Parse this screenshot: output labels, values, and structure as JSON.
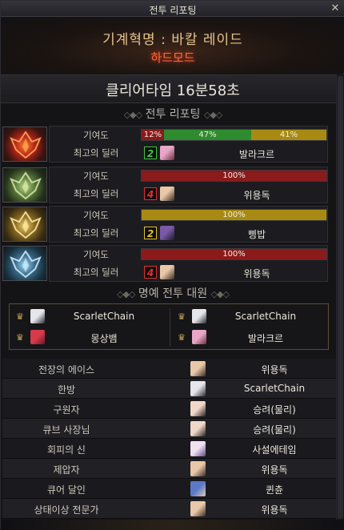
{
  "window": {
    "title": "전투 리포팅",
    "close_label": "✕"
  },
  "header": {
    "raid_title": "기계혁명 : 바칼 레이드",
    "difficulty": "하드모드"
  },
  "clear": {
    "time_text": "클리어타임  16분58초"
  },
  "sections": {
    "report": "전투 리포팅",
    "honor": "명예 전투 대원",
    "deco_left": "◇◆◇",
    "deco_right": "◇◆◇"
  },
  "labels": {
    "contribution": "기여도",
    "top_dealer": "최고의 딜러"
  },
  "bosses": [
    {
      "portrait": "boss-red-icon",
      "segments": [
        {
          "label": "12%",
          "value": 12,
          "color": "#8b1a1a"
        },
        {
          "label": "47%",
          "value": 47,
          "color": "#2e8b2e"
        },
        {
          "label": "41%",
          "value": 41,
          "color": "#a88a12"
        }
      ],
      "grade": "2",
      "grade_color": "#3fc43f",
      "dealer": "발라크르",
      "avatar_colors": [
        "#e8a6c8",
        "#6a2f3a"
      ]
    },
    {
      "portrait": "boss-green-icon",
      "segments": [
        {
          "label": "100%",
          "value": 100,
          "color": "#8b1a1a"
        }
      ],
      "grade": "4",
      "grade_color": "#e03030",
      "dealer": "위용독",
      "avatar_colors": [
        "#e9c7a8",
        "#3a2a22"
      ]
    },
    {
      "portrait": "boss-gold-icon",
      "segments": [
        {
          "label": "100%",
          "value": 100,
          "color": "#a88a12"
        }
      ],
      "grade": "2",
      "grade_color": "#e0c030",
      "dealer": "삥밥",
      "avatar_colors": [
        "#7a5aa8",
        "#1a1a2a"
      ]
    },
    {
      "portrait": "boss-blue-icon",
      "segments": [
        {
          "label": "100%",
          "value": 100,
          "color": "#8b1a1a"
        }
      ],
      "grade": "4",
      "grade_color": "#e03030",
      "dealer": "위용독",
      "avatar_colors": [
        "#e9c7a8",
        "#3a2a22"
      ]
    }
  ],
  "honor": [
    {
      "name": "ScarletChain",
      "avatar_colors": [
        "#e6e6ea",
        "#2a2a34"
      ]
    },
    {
      "name": "ScarletChain",
      "avatar_colors": [
        "#e6e6ea",
        "#2a2a34"
      ]
    },
    {
      "name": "몽상뱀",
      "avatar_colors": [
        "#d83a4a",
        "#6a1a2a"
      ]
    },
    {
      "name": "발라크르",
      "avatar_colors": [
        "#e8a6c8",
        "#6a2f3a"
      ]
    }
  ],
  "awards": [
    {
      "title": "전장의 에이스",
      "name": "위용독",
      "avatar_colors": [
        "#e9c7a8",
        "#3a2a22"
      ]
    },
    {
      "title": "한방",
      "name": "ScarletChain",
      "avatar_colors": [
        "#e6e6ea",
        "#2a2a34"
      ]
    },
    {
      "title": "구원자",
      "name": "승려(물리)",
      "avatar_colors": [
        "#f0d8c8",
        "#2a2020"
      ]
    },
    {
      "title": "큐브 사장님",
      "name": "승려(물리)",
      "avatar_colors": [
        "#f0d8c8",
        "#2a2020"
      ]
    },
    {
      "title": "회피의 신",
      "name": "사설에테임",
      "avatar_colors": [
        "#f0e0f0",
        "#5a4a8a"
      ]
    },
    {
      "title": "제압자",
      "name": "위용독",
      "avatar_colors": [
        "#e9c7a8",
        "#3a2a22"
      ]
    },
    {
      "title": "큐어 달인",
      "name": "퀸츈",
      "avatar_colors": [
        "#5a7ac8",
        "#e0c8b0"
      ]
    },
    {
      "title": "상태이상 전문가",
      "name": "위용독",
      "avatar_colors": [
        "#e9c7a8",
        "#3a2a22"
      ]
    }
  ]
}
